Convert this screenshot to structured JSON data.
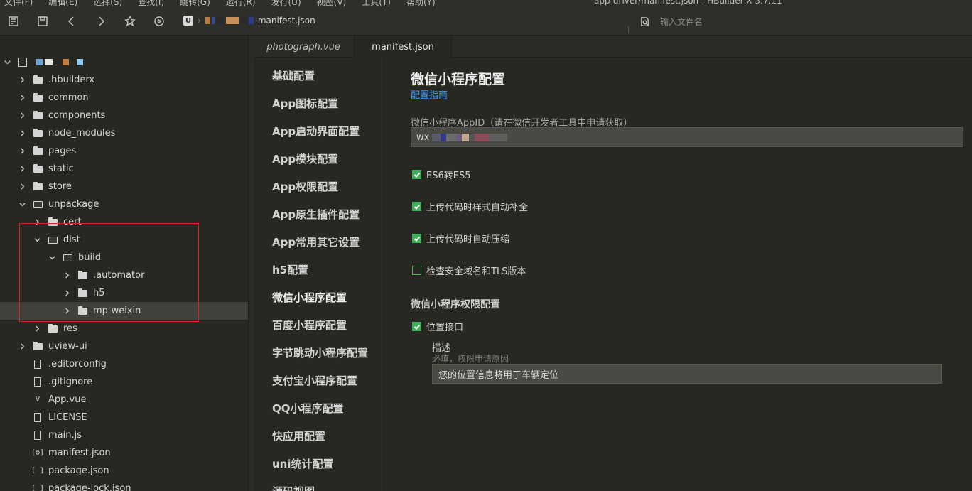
{
  "menubar": {
    "items": [
      "文件(F)",
      "编辑(E)",
      "选择(S)",
      "查找(I)",
      "跳转(G)",
      "运行(R)",
      "发行(U)",
      "视图(V)",
      "工具(T)",
      "帮助(Y)"
    ],
    "window_title": "app-driver/manifest.json - HBuilder X 3.7.11"
  },
  "toolbar": {
    "breadcrumb_root_glyph": "U",
    "breadcrumb_file": "manifest.json",
    "file_search_placeholder": "输入文件名"
  },
  "sidebar": {
    "tree": [
      {
        "label": "",
        "depth": 0,
        "kind": "project",
        "expanded": true
      },
      {
        "label": ".hbuilderx",
        "depth": 1,
        "kind": "folder",
        "expanded": false
      },
      {
        "label": "common",
        "depth": 1,
        "kind": "folder",
        "expanded": false
      },
      {
        "label": "components",
        "depth": 1,
        "kind": "folder",
        "expanded": false
      },
      {
        "label": "node_modules",
        "depth": 1,
        "kind": "folder",
        "expanded": false
      },
      {
        "label": "pages",
        "depth": 1,
        "kind": "folder",
        "expanded": false
      },
      {
        "label": "static",
        "depth": 1,
        "kind": "folder",
        "expanded": false
      },
      {
        "label": "store",
        "depth": 1,
        "kind": "folder",
        "expanded": false
      },
      {
        "label": "unpackage",
        "depth": 1,
        "kind": "folder-open",
        "expanded": true
      },
      {
        "label": "cert",
        "depth": 2,
        "kind": "folder",
        "expanded": false
      },
      {
        "label": "dist",
        "depth": 2,
        "kind": "folder-open",
        "expanded": true
      },
      {
        "label": "build",
        "depth": 3,
        "kind": "folder-open",
        "expanded": true
      },
      {
        "label": ".automator",
        "depth": 4,
        "kind": "folder",
        "expanded": false
      },
      {
        "label": "h5",
        "depth": 4,
        "kind": "folder",
        "expanded": false
      },
      {
        "label": "mp-weixin",
        "depth": 4,
        "kind": "folder",
        "expanded": false,
        "selected": true
      },
      {
        "label": "res",
        "depth": 2,
        "kind": "folder",
        "expanded": false
      },
      {
        "label": "uview-ui",
        "depth": 1,
        "kind": "folder",
        "expanded": false
      },
      {
        "label": ".editorconfig",
        "depth": 1,
        "kind": "file"
      },
      {
        "label": ".gitignore",
        "depth": 1,
        "kind": "file"
      },
      {
        "label": "App.vue",
        "depth": 1,
        "kind": "vue"
      },
      {
        "label": "LICENSE",
        "depth": 1,
        "kind": "file"
      },
      {
        "label": "main.js",
        "depth": 1,
        "kind": "js"
      },
      {
        "label": "manifest.json",
        "depth": 1,
        "kind": "settings"
      },
      {
        "label": "package.json",
        "depth": 1,
        "kind": "json"
      },
      {
        "label": "package-lock.json",
        "depth": 1,
        "kind": "json"
      }
    ]
  },
  "tabs": [
    {
      "label": "photograph.vue",
      "active": false
    },
    {
      "label": "manifest.json",
      "active": true
    }
  ],
  "config_nav": {
    "items": [
      "基础配置",
      "App图标配置",
      "App启动界面配置",
      "App模块配置",
      "App权限配置",
      "App原生插件配置",
      "App常用其它设置",
      "h5配置",
      "微信小程序配置",
      "百度小程序配置",
      "字节跳动小程序配置",
      "支付宝小程序配置",
      "QQ小程序配置",
      "快应用配置",
      "uni统计配置",
      "源码视图"
    ],
    "active_index": 8
  },
  "content": {
    "title": "微信小程序配置",
    "guide_link": "配置指南",
    "appid_label": "微信小程序AppID（请在微信开发者工具中申请获取）",
    "appid_value": "wx",
    "checkboxes": [
      {
        "label": "ES6转ES5",
        "checked": true
      },
      {
        "label": "上传代码时样式自动补全",
        "checked": true
      },
      {
        "label": "上传代码时自动压缩",
        "checked": true
      },
      {
        "label": "检查安全域名和TLS版本",
        "checked": false
      }
    ],
    "permission_title": "微信小程序权限配置",
    "location_checkbox": {
      "label": "位置接口",
      "checked": true
    },
    "desc_label": "描述",
    "desc_hint": "必填，权限申请原因",
    "desc_value": "您的位置信息将用于车辆定位"
  },
  "colors": {
    "background": "#272822",
    "accent_link": "#3f9bff",
    "checkbox_green": "#3fae58",
    "highlight_box": "#e0201f"
  }
}
